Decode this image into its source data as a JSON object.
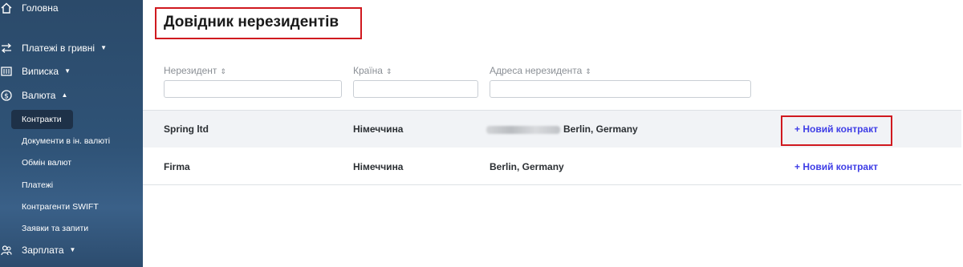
{
  "sidebar": {
    "home_label": "Головна",
    "payments_uah_label": "Платежі в гривні",
    "statement_label": "Виписка",
    "currency_label": "Валюта",
    "currency_items": [
      "Контракти",
      "Документи в ін. валюті",
      "Обмін валют",
      "Платежі",
      "Контрагенти SWIFT",
      "Заявки та запити"
    ],
    "salary_label": "Зарплата",
    "icons": [
      "home-icon",
      "transfer-icon",
      "statement-icon",
      "dollar-icon",
      "people-icon"
    ]
  },
  "page": {
    "title": "Довідник нерезидентів"
  },
  "table": {
    "columns": [
      {
        "label": "Нерезидент",
        "sort_glyph": "⇕"
      },
      {
        "label": "Країна",
        "sort_glyph": "⇕"
      },
      {
        "label": "Адреса нерезидента",
        "sort_glyph": "⇕"
      }
    ],
    "rows": [
      {
        "name": "Spring ltd",
        "country": "Німеччина",
        "address": "Berlin, Germany",
        "action": "+ Новий контракт"
      },
      {
        "name": "Firma",
        "country": "Німеччина",
        "address": "Berlin, Germany",
        "action": "+ Новий контракт"
      }
    ]
  },
  "colors": {
    "sidebar_bg": "#2f5377",
    "highlight_border": "#d0191f",
    "link": "#3f3ee6"
  }
}
